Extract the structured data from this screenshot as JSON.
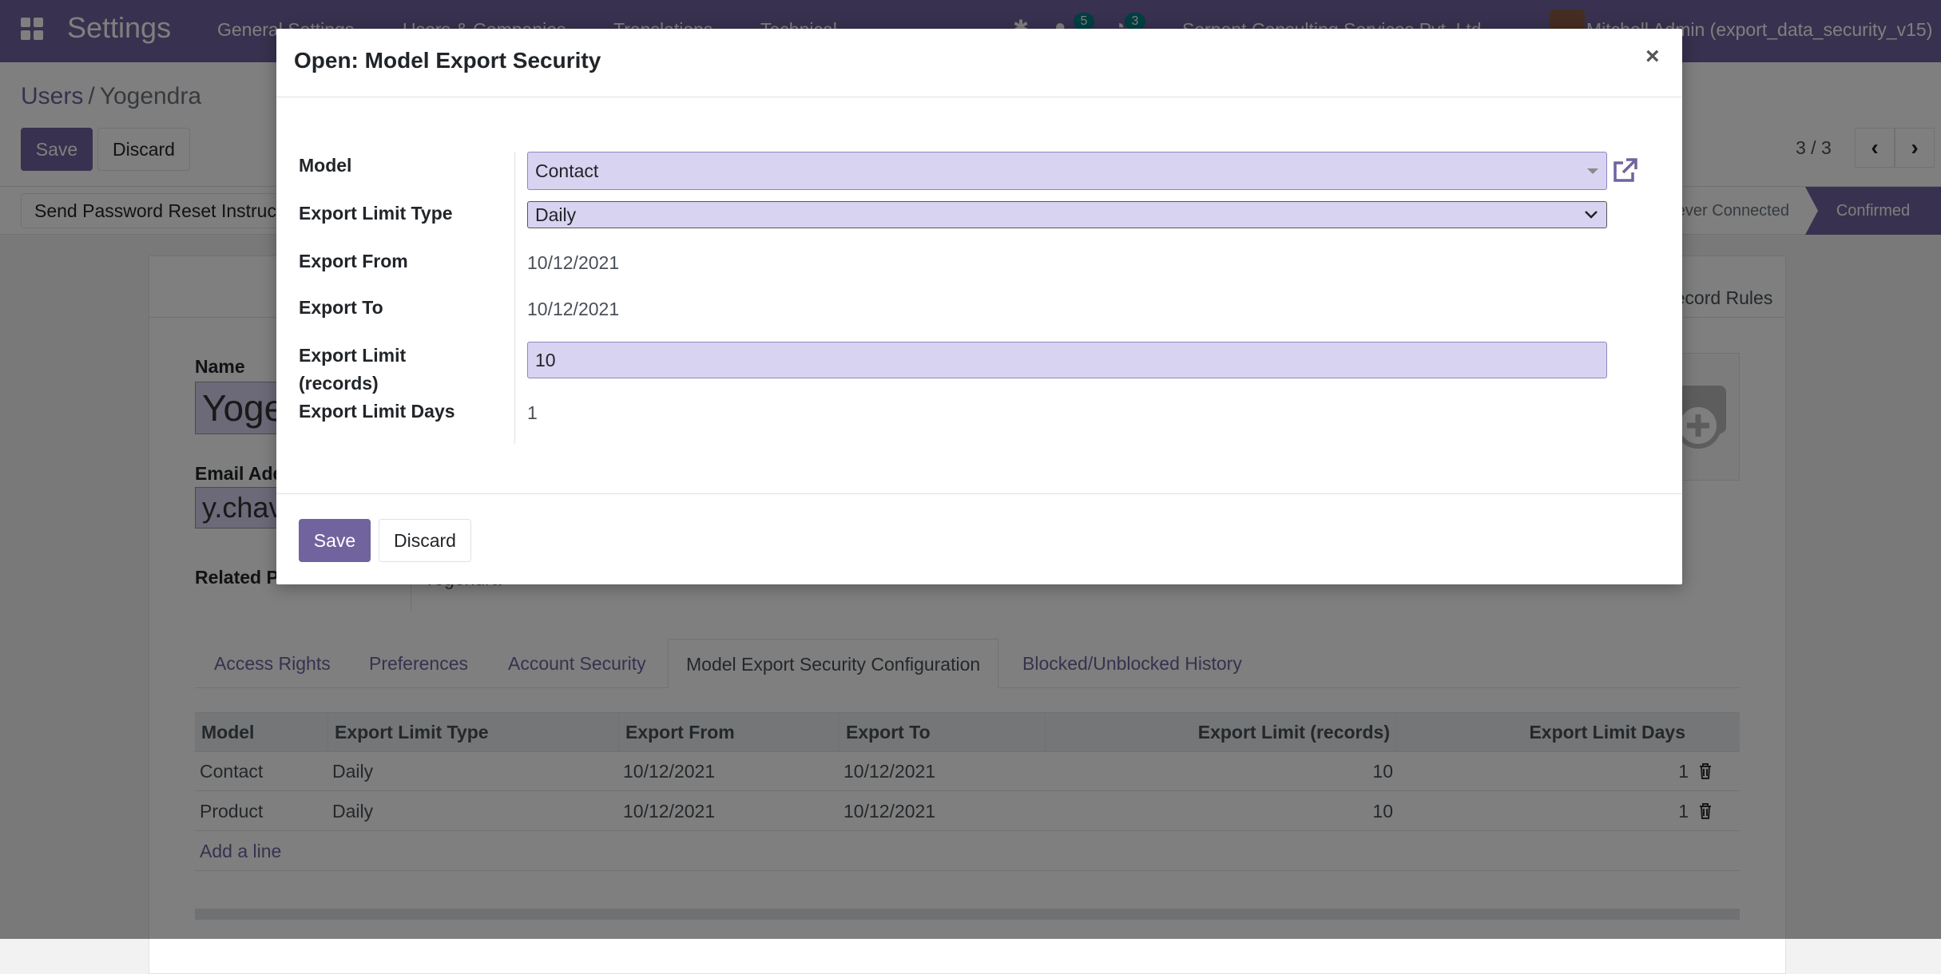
{
  "navbar": {
    "app_title": "Settings",
    "menus": [
      "General Settings",
      "Users & Companies",
      "Translations",
      "Technical"
    ],
    "messages_count": "5",
    "activities_count": "3",
    "company": "Serpent Consulting Services Pvt. Ltd.",
    "user": "Mitchell Admin (export_data_security_v15)"
  },
  "breadcrumb": {
    "parent": "Users",
    "current": "Yogendra"
  },
  "control": {
    "save": "Save",
    "discard": "Discard",
    "pager": "3 / 3"
  },
  "statusbar": {
    "reset_button": "Send Password Reset Instructions",
    "stage_never": "Never Connected",
    "stage_confirmed": "Confirmed"
  },
  "form": {
    "record_rules": "Record Rules",
    "name_label": "Name",
    "name_value": "Yogendra",
    "email_label": "Email Address",
    "email_value": "y.chavda",
    "related_label": "Related Partner",
    "related_value": "Yogendra"
  },
  "tabs": [
    "Access Rights",
    "Preferences",
    "Account Security",
    "Model Export Security Configuration",
    "Blocked/Unblocked History"
  ],
  "table": {
    "headers": [
      "Model",
      "Export Limit Type",
      "Export From",
      "Export To",
      "Export Limit (records)",
      "Export Limit Days"
    ],
    "rows": [
      [
        "Contact",
        "Daily",
        "10/12/2021",
        "10/12/2021",
        "10",
        "1"
      ],
      [
        "Product",
        "Daily",
        "10/12/2021",
        "10/12/2021",
        "10",
        "1"
      ]
    ],
    "add_line": "Add a line"
  },
  "modal": {
    "title": "Open: Model Export Security",
    "close": "×",
    "fields": {
      "model_label": "Model",
      "model_value": "Contact",
      "limit_type_label": "Export Limit Type",
      "limit_type_value": "Daily",
      "from_label": "Export From",
      "from_value": "10/12/2021",
      "to_label": "Export To",
      "to_value": "10/12/2021",
      "limit_records_label": "Export Limit (records)",
      "limit_records_value": "10",
      "limit_days_label": "Export Limit Days",
      "limit_days_value": "1"
    },
    "save": "Save",
    "discard": "Discard"
  },
  "colors": {
    "brand": "#71639e",
    "input_bg": "#d8d3f0",
    "badge": "#017e84"
  }
}
